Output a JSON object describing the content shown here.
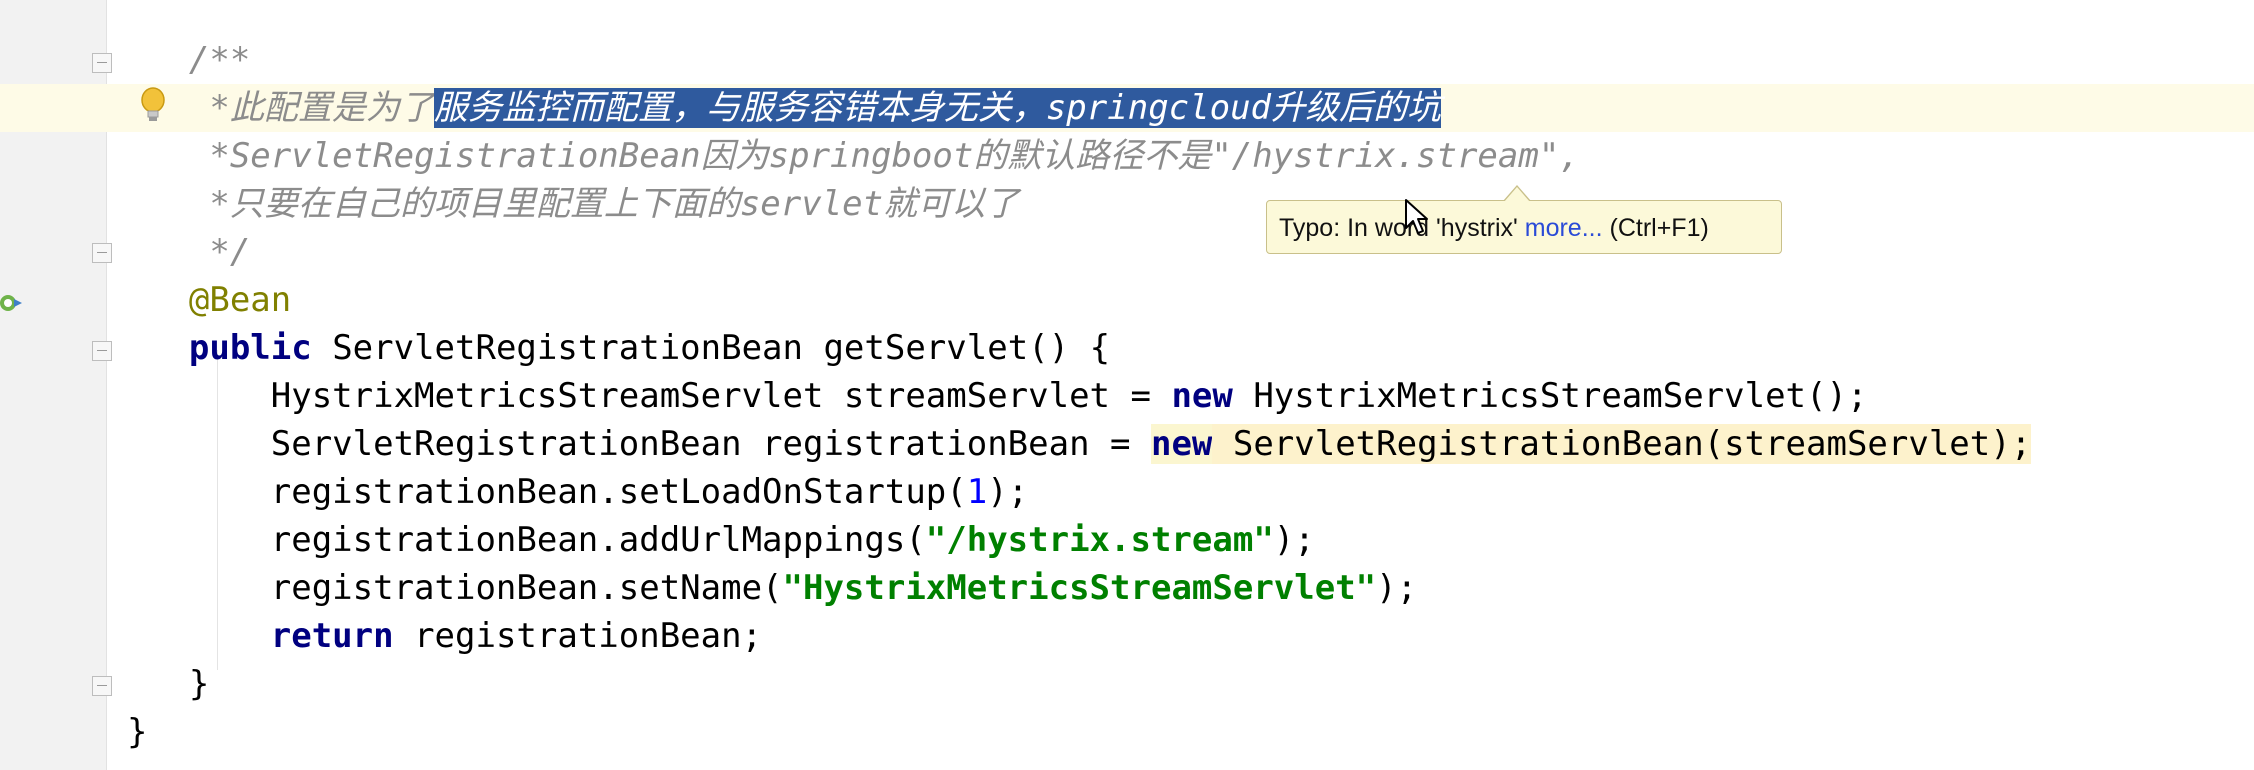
{
  "editor": {
    "lines": [
      {
        "indent": "    ",
        "text": "/**"
      },
      {
        "indent": "     ",
        "comment_plain": "*此配置是为了",
        "comment_selected": "服务监控而配置，与服务容错本身无关，springcloud升级后的坑"
      },
      {
        "indent": "     ",
        "text": "*ServletRegistrationBean因为springboot的默认路径不是\"/hystrix.stream\","
      },
      {
        "indent": "     ",
        "text": "*只要在自己的项目里配置上下面的servlet就可以了"
      },
      {
        "indent": "     ",
        "text": "*/"
      },
      {
        "indent": "    ",
        "text": "@Bean"
      },
      {
        "indent": "    ",
        "kw": "public",
        "rest": " ServletRegistrationBean getServlet() {"
      },
      {
        "indent": "        ",
        "pre": "HystrixMetricsStreamServlet streamServlet = ",
        "kw": "new",
        "rest": " HystrixMetricsStreamServlet();"
      },
      {
        "indent": "        ",
        "pre": "ServletRegistrationBean registrationBean = ",
        "kw": "new",
        "rest": " ServletRegistrationBean(streamServlet);"
      },
      {
        "indent": "        ",
        "pre": "registrationBean.setLoadOnStartup(",
        "num": "1",
        "rest": ");"
      },
      {
        "indent": "        ",
        "pre": "registrationBean.addUrlMappings(",
        "str": "\"/hystrix.stream\"",
        "rest": ");"
      },
      {
        "indent": "        ",
        "pre": "registrationBean.setName(",
        "str": "\"HystrixMetricsStreamServlet\"",
        "rest": ");"
      },
      {
        "indent": "        ",
        "kw": "return",
        "rest": " registrationBean;"
      },
      {
        "indent": "    ",
        "text": "}"
      },
      {
        "indent": "",
        "text": "}"
      }
    ]
  },
  "tooltip": {
    "prefix": "Typo: In word 'hystrix' ",
    "link": "more...",
    "shortcut": " (Ctrl+F1)"
  },
  "icons": {
    "intention": "lightbulb-icon",
    "bean": "spring-bean-icon",
    "fold": "fold-marker-icon",
    "cursor": "mouse-pointer-icon"
  },
  "colors": {
    "keyword": "#000080",
    "comment": "#8c8c8c",
    "annotation": "#808000",
    "string": "#008000",
    "selection": "#2f5a9e",
    "tooltip_bg": "#fcf9d9"
  }
}
